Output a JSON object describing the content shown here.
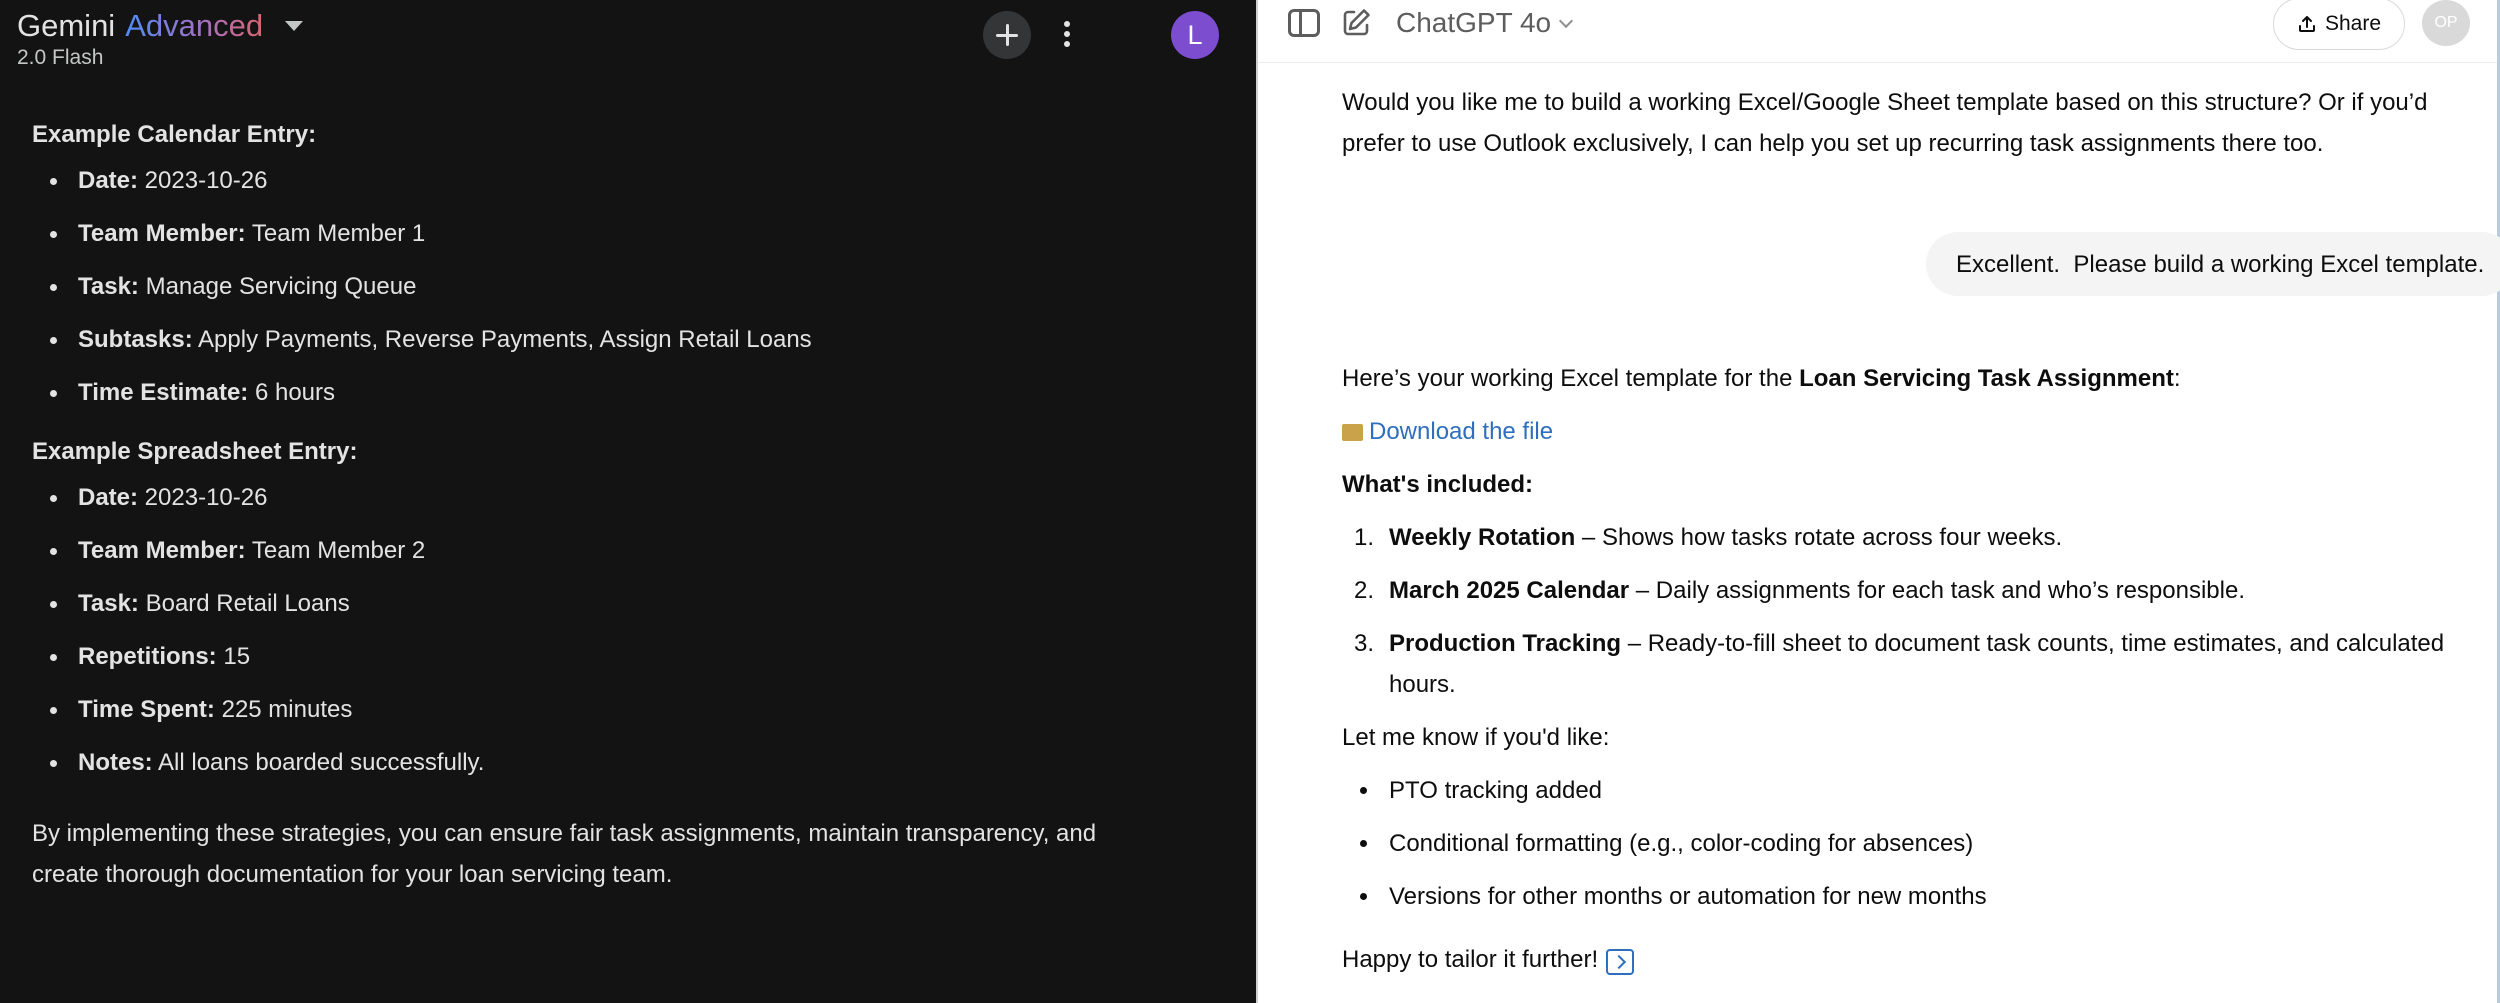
{
  "gemini": {
    "title": "Gemini",
    "title_accent": "Advanced",
    "model": "2.0 Flash",
    "avatar_letter": "L",
    "calendar_heading": "Example Calendar Entry:",
    "calendar_items": [
      {
        "label": "Date:",
        "value": " 2023-10-26"
      },
      {
        "label": "Team Member:",
        "value": " Team Member 1"
      },
      {
        "label": "Task:",
        "value": " Manage Servicing Queue"
      },
      {
        "label": "Subtasks:",
        "value": " Apply Payments, Reverse Payments, Assign Retail Loans"
      },
      {
        "label": "Time Estimate:",
        "value": " 6 hours"
      }
    ],
    "spreadsheet_heading": "Example Spreadsheet Entry:",
    "spreadsheet_items": [
      {
        "label": "Date:",
        "value": " 2023-10-26"
      },
      {
        "label": "Team Member:",
        "value": " Team Member 2"
      },
      {
        "label": "Task:",
        "value": " Board Retail Loans"
      },
      {
        "label": "Repetitions:",
        "value": " 15"
      },
      {
        "label": "Time Spent:",
        "value": " 225 minutes"
      },
      {
        "label": "Notes:",
        "value": " All loans boarded successfully."
      }
    ],
    "closing": "By implementing these strategies, you can ensure fair task assignments, maintain transparency, and create thorough documentation for your loan servicing team."
  },
  "chatgpt": {
    "model": "ChatGPT 4o",
    "share_label": "Share",
    "avatar_initials": "OP",
    "intro": "Would you like me to build a working Excel/Google Sheet template based on this structure? Or if you’d prefer to use Outlook exclusively, I can help you set up recurring task assignments there too.",
    "user_message": "Excellent.  Please build a working Excel template.",
    "reply_lead": "Here’s your working Excel template for the ",
    "reply_bold": "Loan Servicing Task Assignment",
    "reply_tail": ":",
    "download_link": "Download the file",
    "included_heading": "What's included:",
    "included": [
      {
        "num": "1.",
        "title": "Weekly Rotation",
        "desc": " – Shows how tasks rotate across four weeks."
      },
      {
        "num": "2.",
        "title": "March 2025 Calendar",
        "desc": " – Daily assignments for each task and who’s responsible."
      },
      {
        "num": "3.",
        "title": "Production Tracking",
        "desc": " – Ready-to-fill sheet to document task counts, time estimates, and calculated hours."
      }
    ],
    "letme": "Let me know if you'd like:",
    "options": [
      "PTO tracking added",
      "Conditional formatting (e.g., color-coding for absences)",
      "Versions for other months or automation for new months"
    ],
    "happy": "Happy to tailor it further!"
  }
}
